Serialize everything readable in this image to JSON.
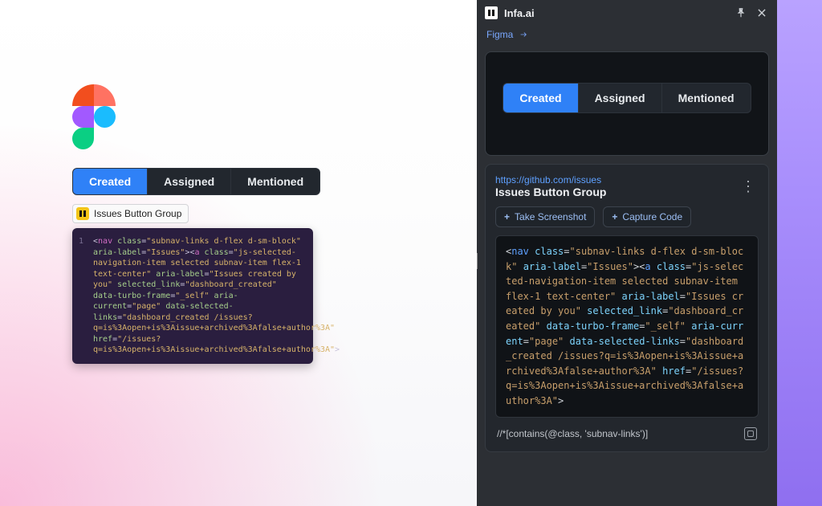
{
  "tabs": {
    "created": "Created",
    "assigned": "Assigned",
    "mentioned": "Mentioned"
  },
  "label_chip": {
    "text": "Issues Button Group"
  },
  "left_code_tokens": [
    {
      "t": "pre",
      "v": "<"
    },
    {
      "t": "tag",
      "v": "nav"
    },
    {
      "t": "pre",
      "v": " "
    },
    {
      "t": "attr",
      "v": "class"
    },
    {
      "t": "eq",
      "v": "="
    },
    {
      "t": "str",
      "v": "\"subnav-links d-flex d-sm-block\""
    },
    {
      "t": "pre",
      "v": " "
    },
    {
      "t": "attr",
      "v": "aria-label"
    },
    {
      "t": "eq",
      "v": "="
    },
    {
      "t": "str",
      "v": "\"Issues\""
    },
    {
      "t": "pre",
      "v": "><"
    },
    {
      "t": "tag",
      "v": "a"
    },
    {
      "t": "pre",
      "v": " "
    },
    {
      "t": "attr",
      "v": "class"
    },
    {
      "t": "eq",
      "v": "="
    },
    {
      "t": "str",
      "v": "\"js-selected-navigation-item selected subnav-item flex-1 text-center\""
    },
    {
      "t": "pre",
      "v": " "
    },
    {
      "t": "attr",
      "v": "aria-label"
    },
    {
      "t": "eq",
      "v": "="
    },
    {
      "t": "str",
      "v": "\"Issues created by you\""
    },
    {
      "t": "pre",
      "v": " "
    },
    {
      "t": "attr",
      "v": "selected_link"
    },
    {
      "t": "eq",
      "v": "="
    },
    {
      "t": "str",
      "v": "\"dashboard_created\""
    },
    {
      "t": "pre",
      "v": " "
    },
    {
      "t": "attr",
      "v": "data-turbo-frame"
    },
    {
      "t": "eq",
      "v": "="
    },
    {
      "t": "str",
      "v": "\"_self\""
    },
    {
      "t": "pre",
      "v": " "
    },
    {
      "t": "attr",
      "v": "aria-current"
    },
    {
      "t": "eq",
      "v": "="
    },
    {
      "t": "str",
      "v": "\"page\""
    },
    {
      "t": "pre",
      "v": " "
    },
    {
      "t": "attr",
      "v": "data-selected-links"
    },
    {
      "t": "eq",
      "v": "="
    },
    {
      "t": "str",
      "v": "\"dashboard_created /issues?q=is%3Aopen+is%3Aissue+archived%3Afalse+author%3A\""
    },
    {
      "t": "pre",
      "v": " "
    },
    {
      "t": "attr",
      "v": "href"
    },
    {
      "t": "eq",
      "v": "="
    },
    {
      "t": "str",
      "v": "\"/issues?q=is%3Aopen+is%3Aissue+archived%3Afalse+author%3A\""
    },
    {
      "t": "pre",
      "v": ">"
    }
  ],
  "panel": {
    "app_name": "Infa.ai",
    "breadcrumb": "Figma",
    "meta": {
      "url": "https://github.com/issues",
      "title": "Issues Button Group"
    },
    "actions": {
      "screenshot": "Take Screenshot",
      "capture": "Capture Code"
    },
    "code_tokens": [
      {
        "t": "pre",
        "v": "<"
      },
      {
        "t": "tag",
        "v": "nav"
      },
      {
        "t": "pre",
        "v": " "
      },
      {
        "t": "attr",
        "v": "class"
      },
      {
        "t": "eq",
        "v": "="
      },
      {
        "t": "str",
        "v": "\"subnav-links d-flex d-sm-block\""
      },
      {
        "t": "pre",
        "v": " "
      },
      {
        "t": "attr",
        "v": "aria-label"
      },
      {
        "t": "eq",
        "v": "="
      },
      {
        "t": "str",
        "v": "\"Issues\""
      },
      {
        "t": "pre",
        "v": "><"
      },
      {
        "t": "tag",
        "v": "a"
      },
      {
        "t": "pre",
        "v": " "
      },
      {
        "t": "attr",
        "v": "class"
      },
      {
        "t": "eq",
        "v": "="
      },
      {
        "t": "str",
        "v": "\"js-selected-navigation-item selected subnav-item flex-1 text-center\""
      },
      {
        "t": "pre",
        "v": " "
      },
      {
        "t": "attr",
        "v": "aria-label"
      },
      {
        "t": "eq",
        "v": "="
      },
      {
        "t": "str",
        "v": "\"Issues created by you\""
      },
      {
        "t": "pre",
        "v": " "
      },
      {
        "t": "attr",
        "v": "selected_link"
      },
      {
        "t": "eq",
        "v": "="
      },
      {
        "t": "str",
        "v": "\"dashboard_created\""
      },
      {
        "t": "pre",
        "v": " "
      },
      {
        "t": "attr",
        "v": "data-turbo-frame"
      },
      {
        "t": "eq",
        "v": "="
      },
      {
        "t": "str",
        "v": "\"_self\""
      },
      {
        "t": "pre",
        "v": " "
      },
      {
        "t": "attr",
        "v": "aria-current"
      },
      {
        "t": "eq",
        "v": "="
      },
      {
        "t": "str",
        "v": "\"page\""
      },
      {
        "t": "pre",
        "v": " "
      },
      {
        "t": "attr",
        "v": "data-selected-links"
      },
      {
        "t": "eq",
        "v": "="
      },
      {
        "t": "str",
        "v": "\"dashboard_created /issues?q=is%3Aopen+is%3Aissue+archived%3Afalse+author%3A\""
      },
      {
        "t": "pre",
        "v": " "
      },
      {
        "t": "attr",
        "v": "href"
      },
      {
        "t": "eq",
        "v": "="
      },
      {
        "t": "str",
        "v": "\"/issues?q=is%3Aopen+is%3Aissue+archived%3Afalse+author%3A\""
      },
      {
        "t": "pre",
        "v": ">"
      }
    ],
    "xpath": "//*[contains(@class, 'subnav-links')]"
  }
}
